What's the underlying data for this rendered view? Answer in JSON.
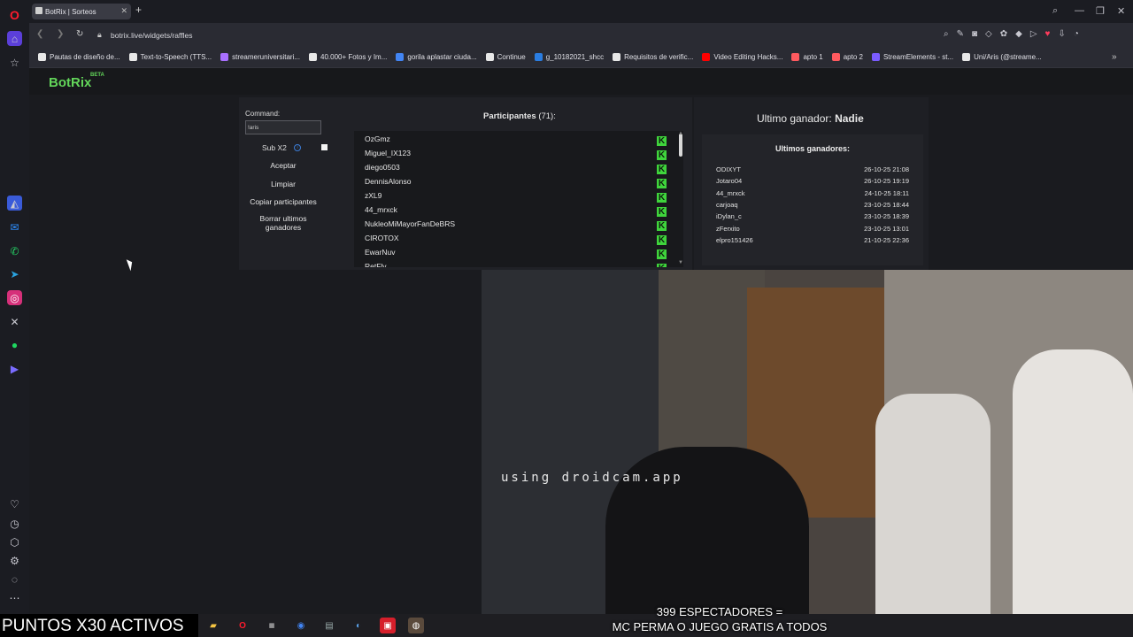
{
  "browser": {
    "tab_title": "BotRix | Sorteos",
    "url": "botrix.live/widgets/raffles",
    "bookmarks": [
      {
        "label": "Pautas de diseño de...",
        "color": "#e8e8e8"
      },
      {
        "label": "Text-to-Speech (TTS...",
        "color": "#e8e8e8"
      },
      {
        "label": "streameruniversitari...",
        "color": "#a970ff"
      },
      {
        "label": "40.000+ Fotos y Im...",
        "color": "#e8e8e8"
      },
      {
        "label": "gorila aplastar ciuda...",
        "color": "#4285f4"
      },
      {
        "label": "Continue",
        "color": "#e8e8e8"
      },
      {
        "label": "g_10182021_shcc",
        "color": "#2a7de1"
      },
      {
        "label": "Requisitos de verific...",
        "color": "#e8e8e8"
      },
      {
        "label": "Video Editing Hacks...",
        "color": "#ff0000"
      },
      {
        "label": "apto 1",
        "color": "#ff5a5f"
      },
      {
        "label": "apto 2",
        "color": "#ff5a5f"
      },
      {
        "label": "StreamElements - st...",
        "color": "#7b5cff"
      },
      {
        "label": "Uni/Aris (@streame...",
        "color": "#e8e8e8"
      }
    ]
  },
  "botrix": {
    "logo": "BotRix",
    "logo_badge": "BETA",
    "command_label": "Command:",
    "command_value": "!aris",
    "sub_label": "Sub X2",
    "sub_info_icon": "i",
    "buttons": {
      "accept": "Aceptar",
      "clear": "Limpiar",
      "copy": "Copiar participantes",
      "delete_winners": "Borrar ultimos ganadores"
    },
    "participants_label": "Participantes",
    "participants_count": "(71):",
    "participants": [
      "OzGmz",
      "Miguel_IX123",
      "diego0503",
      "DennisAlonso",
      "zXL9",
      "44_mrxck",
      "NukleoMiMayorFanDeBRS",
      "CIROTOX",
      "EwarNuv",
      "RetFly"
    ],
    "platform_badge": "K",
    "platform_color": "#3fd43c",
    "last_winner_label": "Ultimo ganador:",
    "last_winner_name": "Nadie",
    "recent_winners_title": "Ultimos ganadores:",
    "recent_winners": [
      {
        "name": "ODIXYT",
        "date": "26-10-25 21:08"
      },
      {
        "name": "Jotaro04",
        "date": "26-10-25 19:19"
      },
      {
        "name": "44_mrxck",
        "date": "24-10-25 18:11"
      },
      {
        "name": "carjoaq",
        "date": "23-10-25 18:44"
      },
      {
        "name": "iDylan_c",
        "date": "23-10-25 18:39"
      },
      {
        "name": "zFerxito",
        "date": "23-10-25 13:01"
      },
      {
        "name": "elpro151426",
        "date": "21-10-25 22:36"
      }
    ]
  },
  "stream": {
    "watermark": "using droidcam.app",
    "ticker": "PUNTOS X30 ACTIVOS",
    "caption_line1": "399 ESPECTADORES =",
    "caption_line2": "MC PERMA O JUEGO GRATIS A TODOS"
  }
}
